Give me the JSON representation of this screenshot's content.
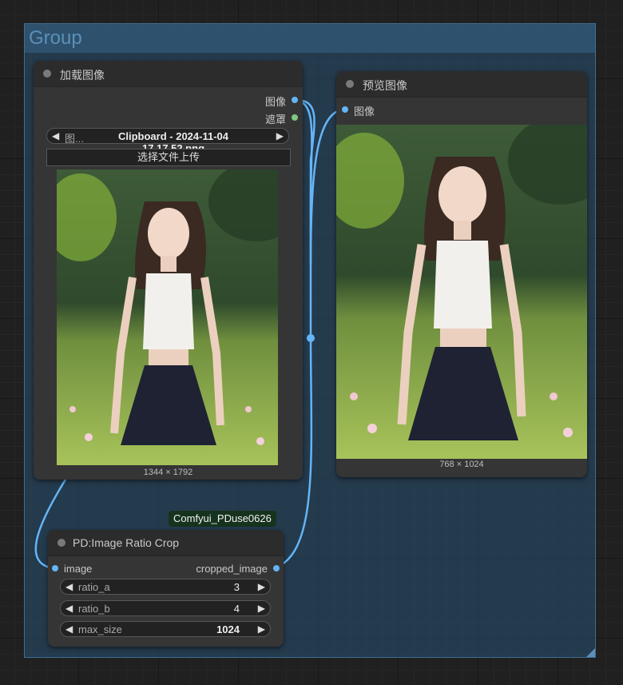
{
  "group": {
    "title": "Group"
  },
  "load_node": {
    "title": "加载图像",
    "outputs": [
      "图像",
      "遮罩"
    ],
    "image_widget": {
      "name": "图...",
      "value": "Clipboard - 2024-11-04 17.17.52.png"
    },
    "upload_button": "选择文件上传",
    "image_size": "1344 × 1792"
  },
  "preview_node": {
    "title": "预览图像",
    "input": "图像",
    "image_size": "768 × 1024"
  },
  "crop_node": {
    "badge": "Comfyui_PDuse0626",
    "title": "PD:Image Ratio Crop",
    "input": "image",
    "output": "cropped_image",
    "widgets": [
      {
        "name": "ratio_a",
        "value": "3"
      },
      {
        "name": "ratio_b",
        "value": "4"
      },
      {
        "name": "max_size",
        "value": "1024"
      }
    ]
  },
  "colors": {
    "image_slot": "#64b5f6",
    "mask_slot": "#81c784",
    "link": "#64b5f6",
    "group_bg": "#28506f"
  },
  "icons": [
    "arrow-left-icon",
    "arrow-right-icon",
    "status-dot-icon"
  ]
}
